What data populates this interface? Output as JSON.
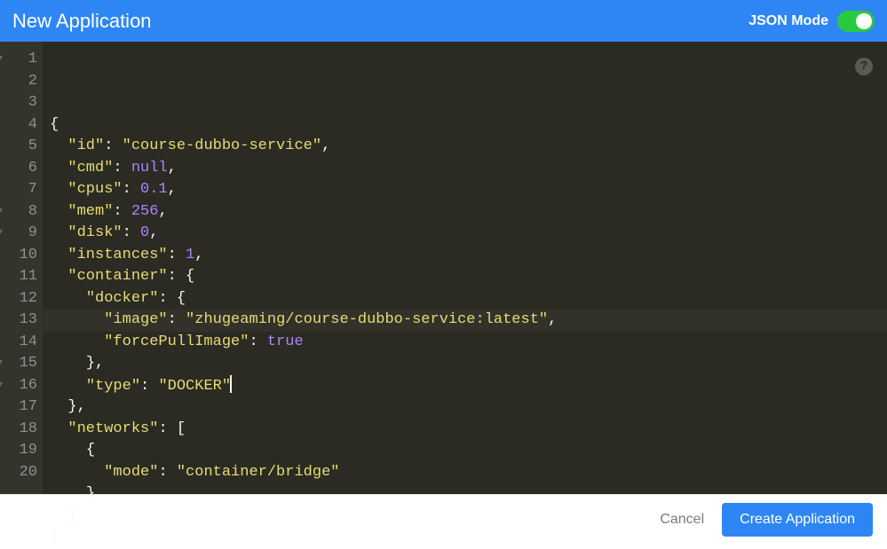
{
  "header": {
    "title": "New Application",
    "json_mode_label": "JSON Mode",
    "json_mode_on": true
  },
  "editor": {
    "line_count": 20,
    "fold_lines": [
      1,
      8,
      9,
      15,
      16
    ],
    "highlight_line": 13,
    "json_config": {
      "id": "course-dubbo-service",
      "cmd": null,
      "cpus": 0.1,
      "mem": 256,
      "disk": 0,
      "instances": 1,
      "container": {
        "docker": {
          "image": "zhugeaming/course-dubbo-service:latest",
          "forcePullImage": true
        },
        "type": "DOCKER"
      },
      "networks": [
        {
          "mode": "container/bridge"
        }
      ]
    },
    "lines": [
      {
        "indent": 0,
        "tokens": [
          {
            "t": "p",
            "v": "{"
          }
        ]
      },
      {
        "indent": 1,
        "tokens": [
          {
            "t": "k",
            "v": "\"id\""
          },
          {
            "t": "p",
            "v": ": "
          },
          {
            "t": "s",
            "v": "\"course-dubbo-service\""
          },
          {
            "t": "p",
            "v": ","
          }
        ]
      },
      {
        "indent": 1,
        "tokens": [
          {
            "t": "k",
            "v": "\"cmd\""
          },
          {
            "t": "p",
            "v": ": "
          },
          {
            "t": "c",
            "v": "null"
          },
          {
            "t": "p",
            "v": ","
          }
        ]
      },
      {
        "indent": 1,
        "tokens": [
          {
            "t": "k",
            "v": "\"cpus\""
          },
          {
            "t": "p",
            "v": ": "
          },
          {
            "t": "n",
            "v": "0.1"
          },
          {
            "t": "p",
            "v": ","
          }
        ]
      },
      {
        "indent": 1,
        "tokens": [
          {
            "t": "k",
            "v": "\"mem\""
          },
          {
            "t": "p",
            "v": ": "
          },
          {
            "t": "n",
            "v": "256"
          },
          {
            "t": "p",
            "v": ","
          }
        ]
      },
      {
        "indent": 1,
        "tokens": [
          {
            "t": "k",
            "v": "\"disk\""
          },
          {
            "t": "p",
            "v": ": "
          },
          {
            "t": "n",
            "v": "0"
          },
          {
            "t": "p",
            "v": ","
          }
        ]
      },
      {
        "indent": 1,
        "tokens": [
          {
            "t": "k",
            "v": "\"instances\""
          },
          {
            "t": "p",
            "v": ": "
          },
          {
            "t": "n",
            "v": "1"
          },
          {
            "t": "p",
            "v": ","
          }
        ]
      },
      {
        "indent": 1,
        "tokens": [
          {
            "t": "k",
            "v": "\"container\""
          },
          {
            "t": "p",
            "v": ": {"
          }
        ]
      },
      {
        "indent": 2,
        "tokens": [
          {
            "t": "k",
            "v": "\"docker\""
          },
          {
            "t": "p",
            "v": ": {"
          }
        ]
      },
      {
        "indent": 3,
        "tokens": [
          {
            "t": "k",
            "v": "\"image\""
          },
          {
            "t": "p",
            "v": ": "
          },
          {
            "t": "s",
            "v": "\"zhugeaming/course-dubbo-service:latest\""
          },
          {
            "t": "p",
            "v": ","
          }
        ]
      },
      {
        "indent": 3,
        "tokens": [
          {
            "t": "k",
            "v": "\"forcePullImage\""
          },
          {
            "t": "p",
            "v": ": "
          },
          {
            "t": "c",
            "v": "true"
          }
        ]
      },
      {
        "indent": 2,
        "tokens": [
          {
            "t": "p",
            "v": "},"
          }
        ]
      },
      {
        "indent": 2,
        "tokens": [
          {
            "t": "k",
            "v": "\"type\""
          },
          {
            "t": "p",
            "v": ": "
          },
          {
            "t": "s",
            "v": "\"DOCKER\""
          }
        ],
        "cursor": true
      },
      {
        "indent": 1,
        "tokens": [
          {
            "t": "p",
            "v": "},"
          }
        ]
      },
      {
        "indent": 1,
        "tokens": [
          {
            "t": "k",
            "v": "\"networks\""
          },
          {
            "t": "p",
            "v": ": ["
          }
        ]
      },
      {
        "indent": 2,
        "tokens": [
          {
            "t": "p",
            "v": "{"
          }
        ]
      },
      {
        "indent": 3,
        "tokens": [
          {
            "t": "k",
            "v": "\"mode\""
          },
          {
            "t": "p",
            "v": ": "
          },
          {
            "t": "s",
            "v": "\"container/bridge\""
          }
        ]
      },
      {
        "indent": 2,
        "tokens": [
          {
            "t": "p",
            "v": "}"
          }
        ]
      },
      {
        "indent": 1,
        "tokens": [
          {
            "t": "p",
            "v": "]"
          }
        ]
      },
      {
        "indent": 0,
        "tokens": [
          {
            "t": "p",
            "v": "}"
          }
        ]
      }
    ]
  },
  "footer": {
    "cancel_label": "Cancel",
    "create_label": "Create Application"
  },
  "help_glyph": "?"
}
